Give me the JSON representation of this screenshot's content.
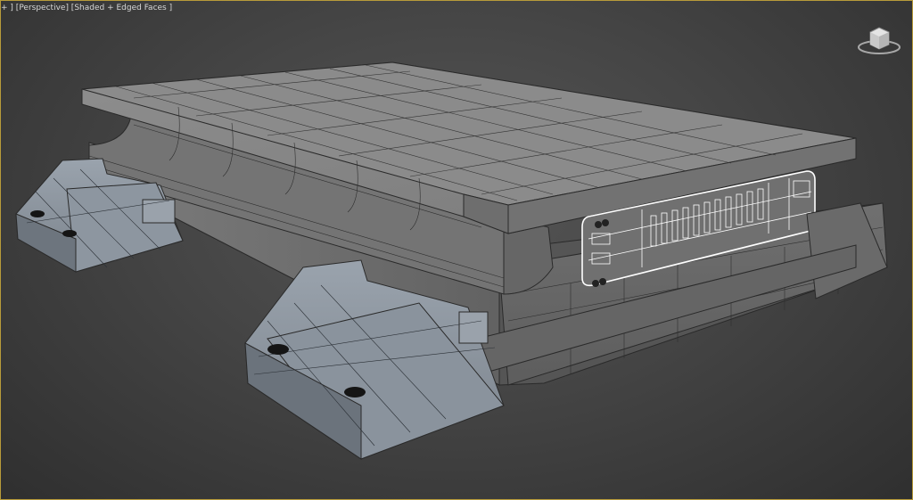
{
  "viewport": {
    "menu_plus": "+",
    "view_name": "Perspective",
    "shading_mode": "Shaded + Edged Faces",
    "active_border_color": "#b89b3a",
    "background_color": "#454545"
  },
  "scene": {
    "object": "sci-fi platform model",
    "mesh_color": "#8a8a8a",
    "wire_color": "#2a2a2a",
    "selected_color": "#ffffff"
  },
  "viewcube": {
    "icon": "viewcube-icon"
  }
}
